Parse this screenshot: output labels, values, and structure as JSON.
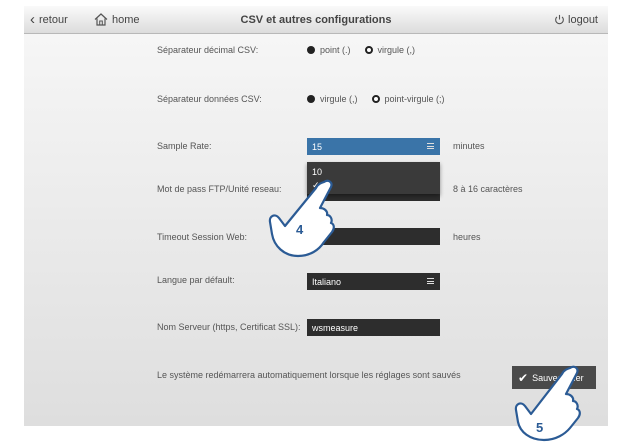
{
  "topbar": {
    "back_label": "retour",
    "home_label": "home",
    "title": "CSV et autres configurations",
    "logout_label": "logout"
  },
  "settings": {
    "decimal_separator": {
      "label": "Séparateur décimal CSV:",
      "options": [
        {
          "label": "point (.)",
          "selected": true
        },
        {
          "label": "virgule (,)",
          "selected": false
        }
      ]
    },
    "data_separator": {
      "label": "Séparateur données CSV:",
      "options": [
        {
          "label": "virgule (,)",
          "selected": true
        },
        {
          "label": "point-virgule (;)",
          "selected": false
        }
      ]
    },
    "sample_rate": {
      "label": "Sample Rate:",
      "value": "15",
      "suffix": "minutes",
      "dropdown_options": [
        "10",
        "✓"
      ]
    },
    "ftp_password": {
      "label": "Mot de pass FTP/Unité reseau:",
      "suffix": "8 à 16 caractères"
    },
    "timeout": {
      "label": "Timeout Session Web:",
      "suffix": "heures"
    },
    "language": {
      "label": "Langue par défault:",
      "value": "Italiano"
    },
    "server_name": {
      "label": "Nom Serveur (https, Certificat SSL):",
      "value": "wsmeasure"
    }
  },
  "footer": {
    "note": "Le système redémarrera automatiquement lorsque les réglages sont sauvés",
    "save_label": "Sauvegarder"
  },
  "steps": {
    "step4": "4",
    "step5": "5"
  }
}
